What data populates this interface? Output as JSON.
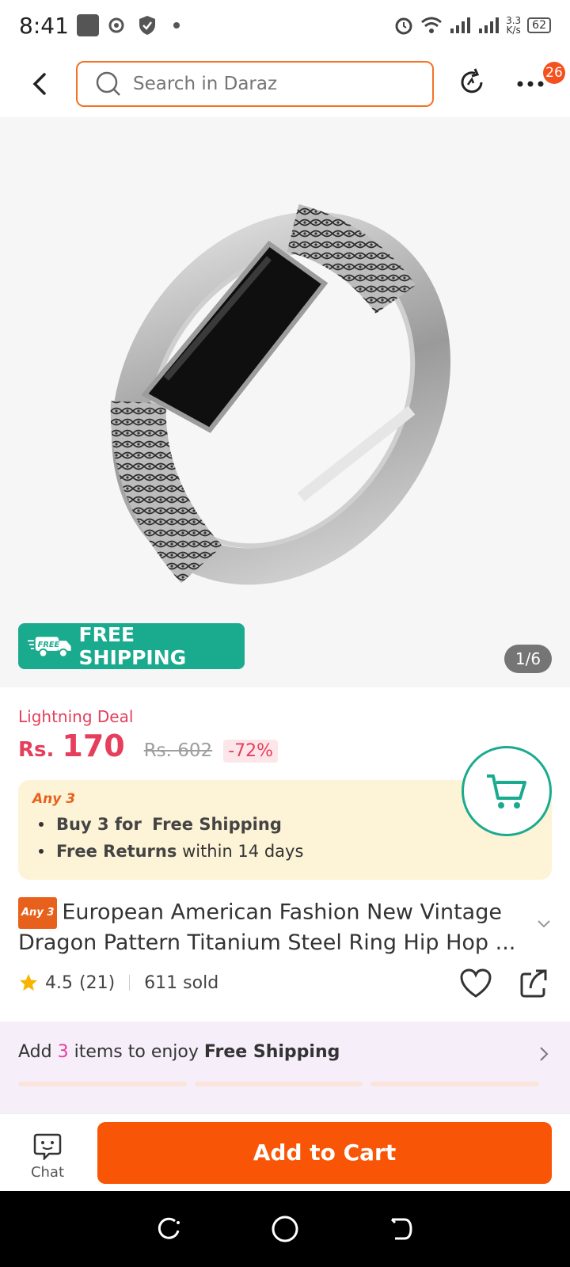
{
  "status_bar": {
    "time": "8:41",
    "net_speed_top": "3.3",
    "net_speed_bottom": "K/s",
    "battery": "62"
  },
  "header": {
    "search_placeholder": "Search in Daraz",
    "notification_count": "26"
  },
  "gallery": {
    "free_shipping_label": "FREE SHIPPING",
    "truck_label": "FREE",
    "counter": "1/6"
  },
  "price": {
    "deal_label": "Lightning Deal",
    "currency": "Rs.",
    "current": "170",
    "original": "Rs. 602",
    "discount": "-72%"
  },
  "promo": {
    "title": "Any 3",
    "line1_bold_a": "Buy 3 for",
    "line1_bold_b": "Free Shipping",
    "line2_bold": "Free Returns",
    "line2_text": "within 14 days"
  },
  "product": {
    "tag": "Any 3",
    "title": "European American Fashion New Vintage Dragon Pattern Titanium Steel Ring Hip Hop ...",
    "rating": "4.5",
    "reviews": "(21)",
    "sold": "611 sold"
  },
  "ship_banner": {
    "text_a": "Add",
    "count": "3",
    "text_b": "items to enjoy",
    "bold": "Free Shipping"
  },
  "bottom_bar": {
    "chat_label": "Chat",
    "add_to_cart": "Add to Cart"
  },
  "colors": {
    "accent": "#f85606",
    "teal": "#1aab8f",
    "price": "#e53f5b"
  }
}
